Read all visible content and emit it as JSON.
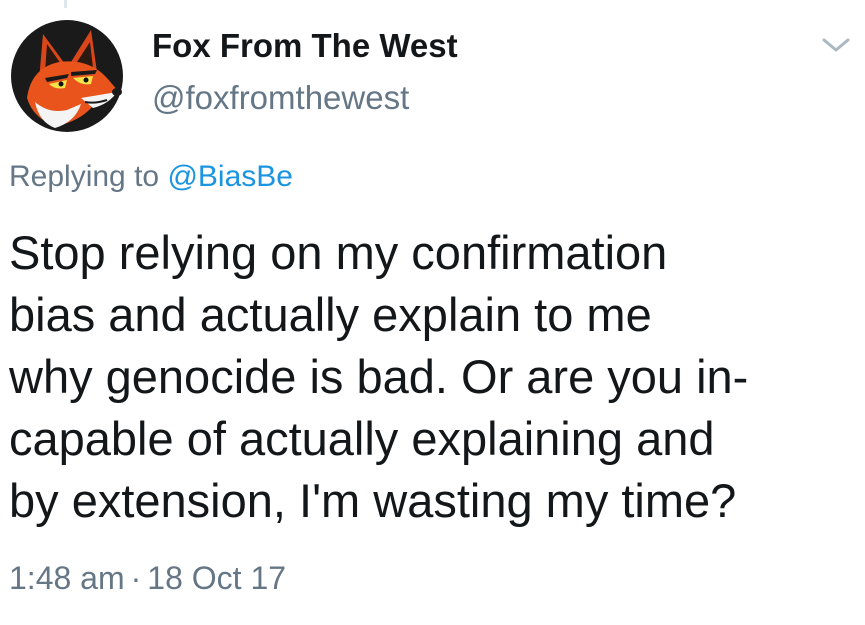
{
  "author": {
    "display_name": "Fox From The West",
    "handle": "@foxfromthewest",
    "avatar_icon": "fox-avatar"
  },
  "reply": {
    "prefix": "Replying to",
    "mention": "@BiasBe"
  },
  "tweet": {
    "lines": [
      "Stop relying on my confirmation",
      "bias and actually explain to me",
      "why genocide is bad. Or are you in-",
      "capable of actually explaining and",
      "by extension, I'm wasting my time?"
    ]
  },
  "meta": {
    "time": "1:48 am",
    "separator": "·",
    "date": "18 Oct 17"
  },
  "colors": {
    "text": "#14171a",
    "secondary": "#657786",
    "link": "#1b95e0",
    "fox_orange": "#e8541c"
  },
  "icons": {
    "menu": "chevron-down-icon"
  }
}
